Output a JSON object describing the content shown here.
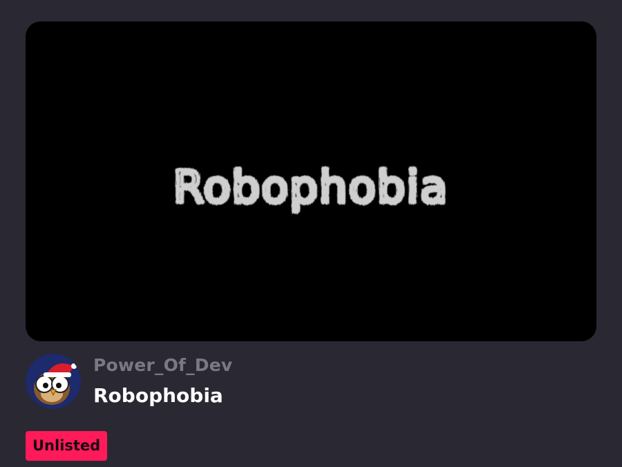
{
  "project": {
    "thumbnail_text": "Robophobia",
    "author": "Power_Of_Dev",
    "title": "Robophobia",
    "status_badge": "Unlisted"
  },
  "icons": {
    "avatar": "owl-avatar-icon"
  },
  "colors": {
    "background": "#2a2833",
    "thumbnail_bg": "#000000",
    "author_text": "#7b7884",
    "title_text": "#ffffff",
    "badge_bg": "#ff1a5a"
  }
}
